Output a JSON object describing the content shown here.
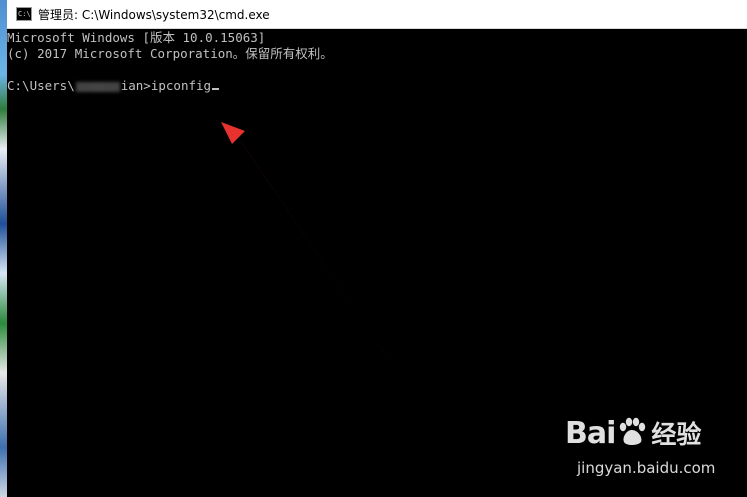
{
  "window": {
    "title": "管理员: C:\\Windows\\system32\\cmd.exe",
    "icon": "cmd-icon",
    "icon_label": "C:\\"
  },
  "console": {
    "line1": "Microsoft Windows [版本 10.0.15063]",
    "line2": "(c) 2017 Microsoft Corporation。保留所有权利。",
    "prompt_prefix": "C:\\Users\\",
    "prompt_suffix": "ian>",
    "command": "ipconfig"
  },
  "annotation": {
    "arrow_color": "#e8322e"
  },
  "watermark": {
    "brand_left": "Bai",
    "brand_right": "经验",
    "url": "jingyan.baidu.com"
  }
}
